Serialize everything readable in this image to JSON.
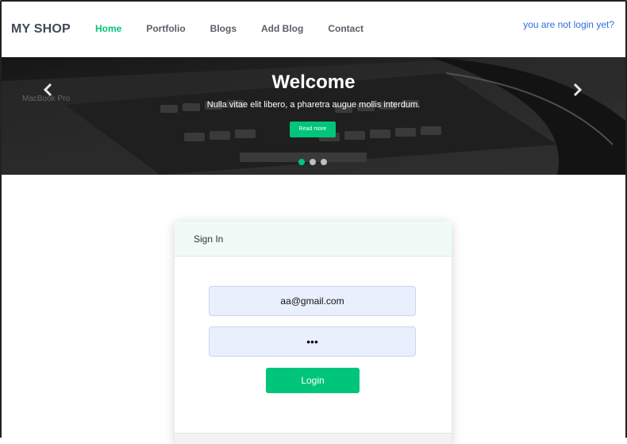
{
  "navbar": {
    "brand": "MY SHOP",
    "links": [
      "Home",
      "Portfolio",
      "Blogs",
      "Add Blog",
      "Contact"
    ],
    "active_index": 0,
    "login_hint": "you are not login yet?"
  },
  "carousel": {
    "title": "Welcome",
    "subtitle": "Nulla vitae elit libero, a pharetra augue mollis interdum.",
    "button_label": "Read more",
    "prev_icon": "chevron-left-icon",
    "next_icon": "chevron-right-icon",
    "slide_count": 3,
    "active_slide": 0,
    "laptop_label": "MacBook Pro"
  },
  "signin": {
    "header": "Sign In",
    "email_value": "aa@gmail.com",
    "password_value": "•••",
    "login_label": "Login"
  },
  "colors": {
    "accent": "#00c57a",
    "link": "#2f6fde"
  }
}
